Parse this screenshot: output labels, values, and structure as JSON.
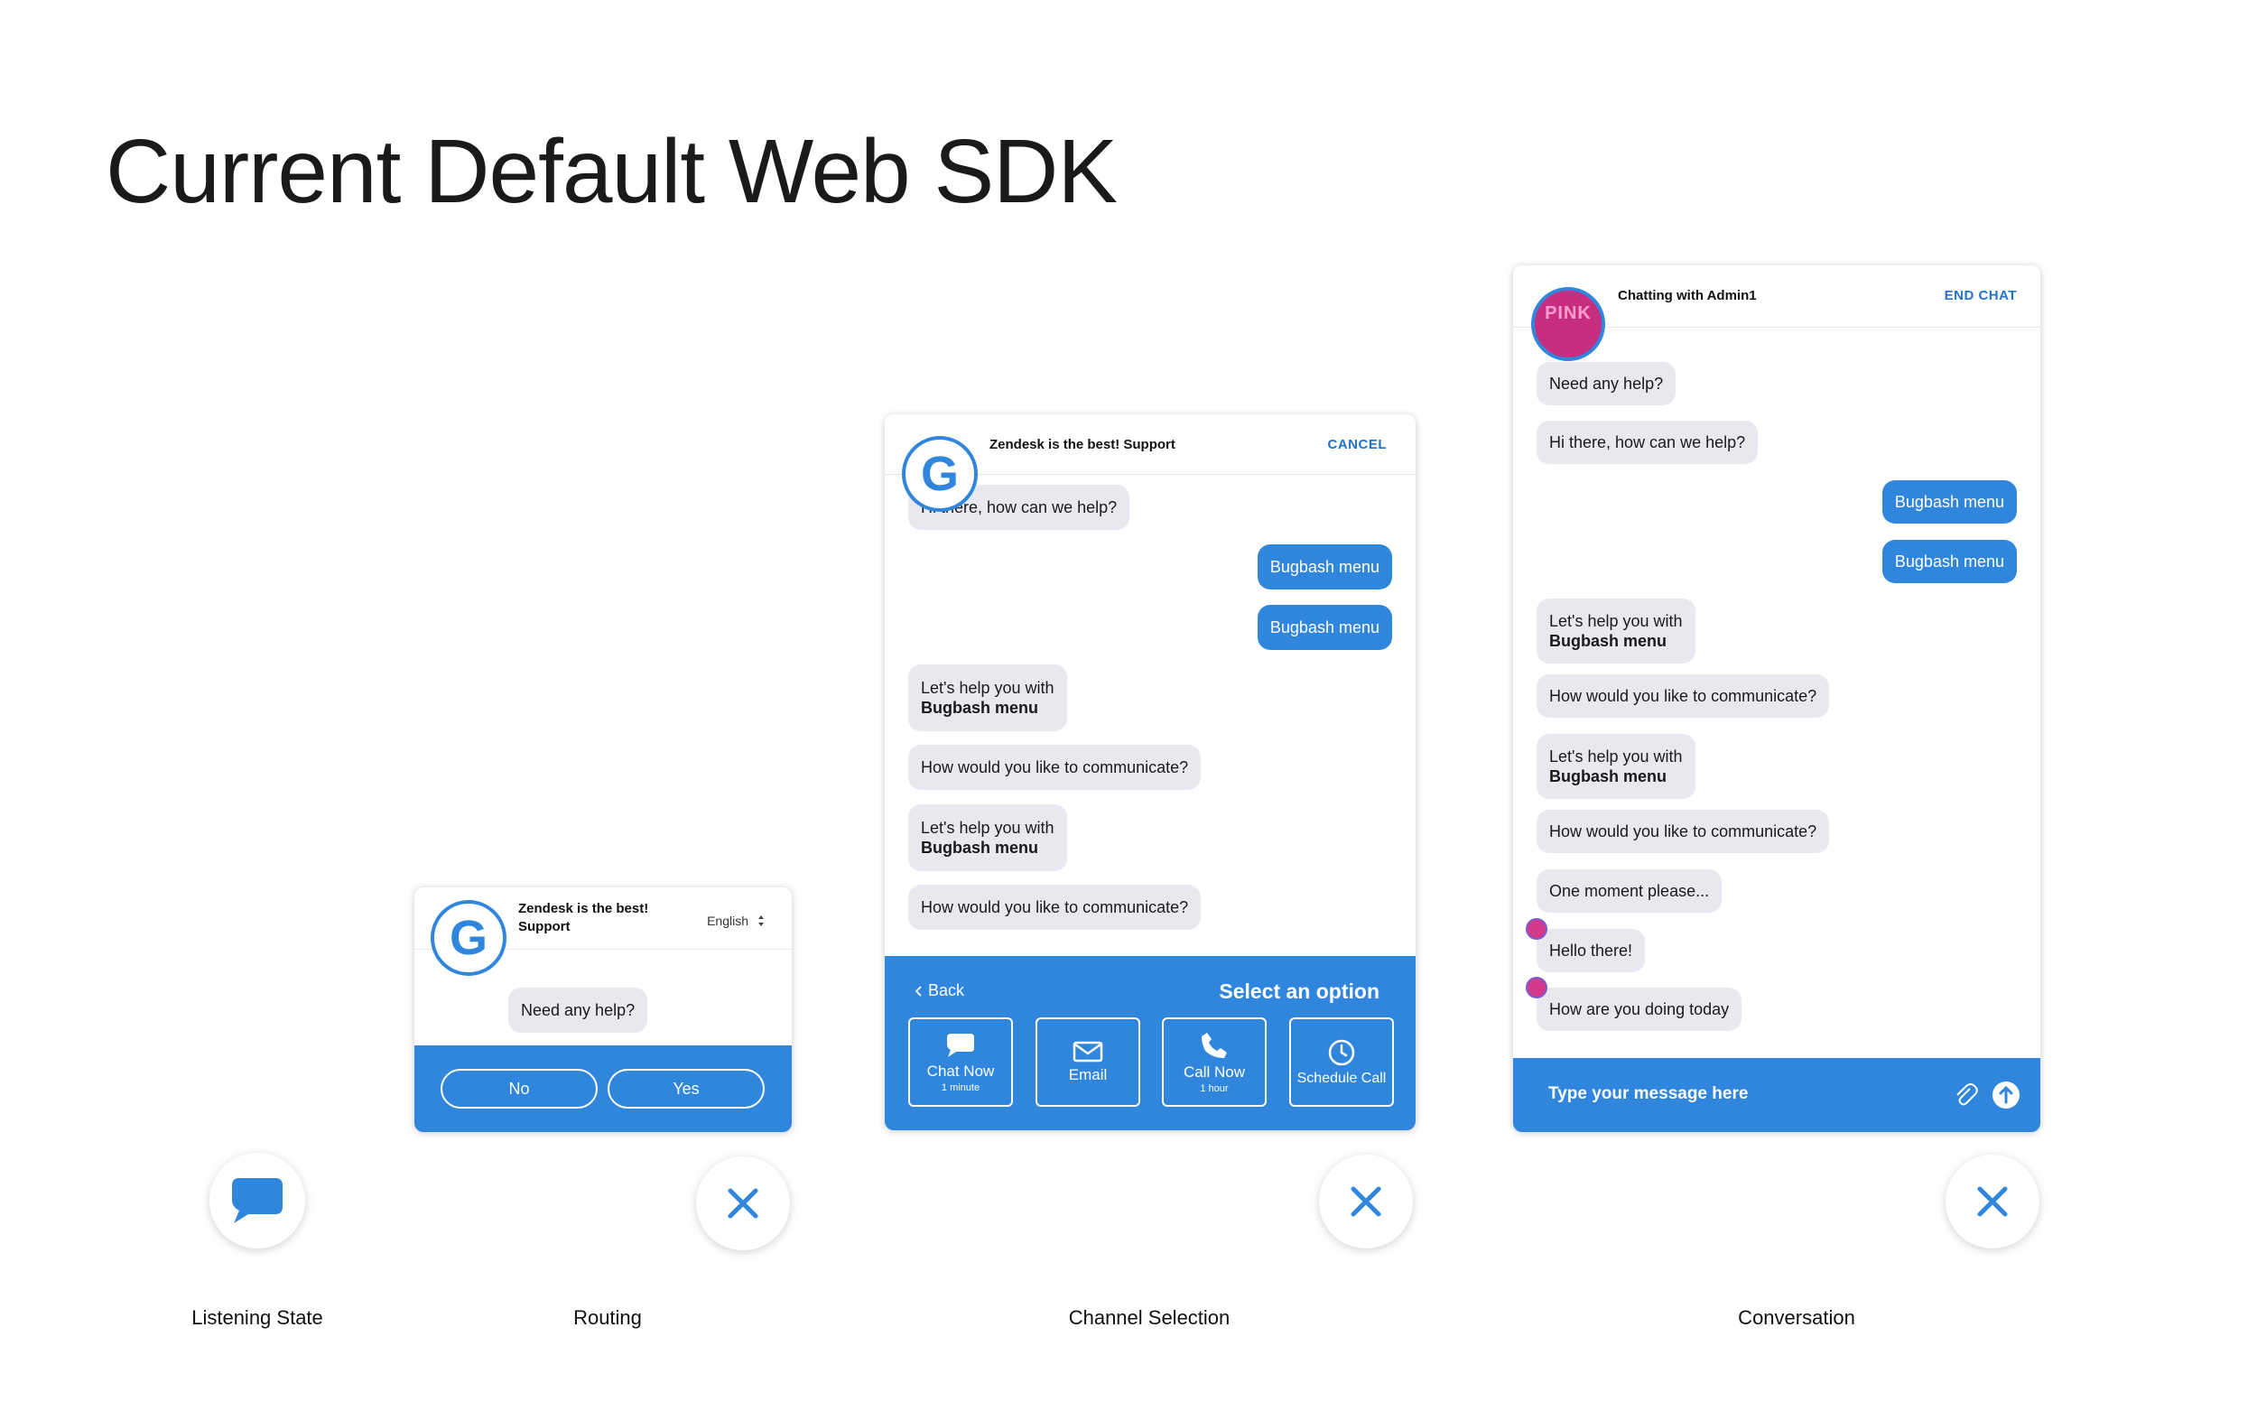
{
  "page": {
    "title": "Current Default Web SDK"
  },
  "captions": {
    "listening": "Listening State",
    "routing": "Routing",
    "channel": "Channel Selection",
    "conversation": "Conversation"
  },
  "routing": {
    "header_title_line1": "Zendesk is the best!",
    "header_title_line2": "Support",
    "language": "English",
    "avatar_letter": "G",
    "message": "Need any help?",
    "no_label": "No",
    "yes_label": "Yes"
  },
  "channel": {
    "header_title": "Zendesk is the best! Support",
    "cancel_label": "CANCEL",
    "avatar_letter": "G",
    "messages": [
      {
        "text": "Hi there, how can we help?"
      },
      {
        "text": "Bugbash menu"
      },
      {
        "text": "Bugbash menu"
      },
      {
        "line1": "Let's help you with",
        "line2": "Bugbash menu"
      },
      {
        "text": "How would you like to communicate?"
      },
      {
        "line1": "Let's help you with",
        "line2": "Bugbash menu"
      },
      {
        "text": "How would you like to communicate?"
      }
    ],
    "back_label": "Back",
    "select_label": "Select an option",
    "options": [
      {
        "label": "Chat Now",
        "sub": "1 minute"
      },
      {
        "label": "Email",
        "sub": ""
      },
      {
        "label": "Call Now",
        "sub": "1 hour"
      },
      {
        "label": "Schedule Call",
        "sub": ""
      }
    ]
  },
  "conversation": {
    "header_title": "Chatting with Admin1",
    "end_label": "END CHAT",
    "avatar_text": "PINK",
    "messages": [
      {
        "text": "Need any help?"
      },
      {
        "text": "Hi there, how can we help?"
      },
      {
        "text": "Bugbash menu"
      },
      {
        "text": "Bugbash menu"
      },
      {
        "line1": "Let's help you with",
        "line2": "Bugbash menu"
      },
      {
        "text": "How would you like to communicate?"
      },
      {
        "line1": "Let's help you with",
        "line2": "Bugbash menu"
      },
      {
        "text": "How would you like to communicate?"
      },
      {
        "text": "One moment please..."
      },
      {
        "text": "Hello there!"
      },
      {
        "text": "How are you doing today"
      }
    ],
    "input_placeholder": "Type your message here"
  },
  "colors": {
    "accent": "#2f86dc",
    "bubble": "#e7e9ee",
    "link": "#1f73c8"
  }
}
